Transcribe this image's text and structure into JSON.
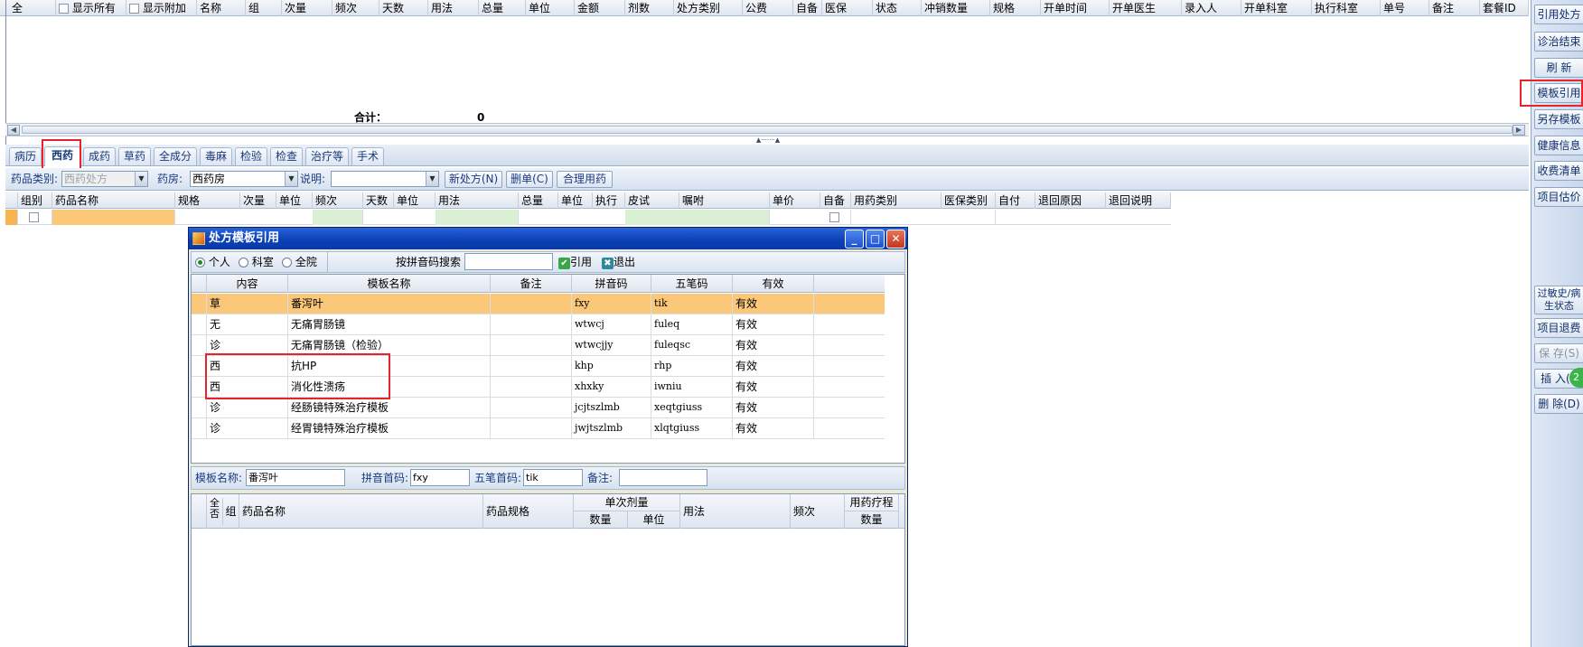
{
  "main_grid": {
    "headers": [
      "全",
      "",
      "显示所有",
      "显示附加",
      "名称",
      "组",
      "次量",
      "频次",
      "天数",
      "用法",
      "总量",
      "单位",
      "金额",
      "剂数",
      "处方类别",
      "公费",
      "自备",
      "医保",
      "状态",
      "冲销数量",
      "规格",
      "开单时间",
      "开单医生",
      "录入人",
      "开单科室",
      "执行科室",
      "单号",
      "备注",
      "套餐ID"
    ],
    "total_label": "合计：",
    "total_value": "0"
  },
  "tabs": [
    "病历",
    "西药",
    "成药",
    "草药",
    "全成分",
    "毒麻",
    "检验",
    "检查",
    "治疗等",
    "手术"
  ],
  "toolbar": {
    "category_label": "药品类别:",
    "category_value": "西药处方",
    "pharmacy_label": "药房:",
    "pharmacy_value": "西药房",
    "note_label": "说明:",
    "note_value": "",
    "new_rx_button": "新处方(N)",
    "delete_button": "删单(C)",
    "rational_button": "合理用药"
  },
  "order_grid": {
    "headers": [
      "组别",
      "药品名称",
      "规格",
      "次量",
      "单位",
      "频次",
      "天数",
      "单位",
      "用法",
      "总量",
      "单位",
      "执行",
      "皮试",
      "嘱咐",
      "单价",
      "自备",
      "用药类别",
      "医保类别",
      "自付",
      "退回原因",
      "退回说明"
    ]
  },
  "sidebar": {
    "buttons": [
      "引用处方",
      "诊治结束",
      "刷  新",
      "模板引用",
      "另存模板",
      "健康信息",
      "收费清单",
      "项目估价"
    ],
    "lower_buttons": [
      "过敏史/病生状态",
      "项目退费",
      "保  存(S)",
      "插  入(I)",
      "删  除(D)"
    ],
    "badge": "2"
  },
  "dialog": {
    "title": "处方模板引用",
    "scope_options": [
      "个人",
      "科室",
      "全院"
    ],
    "scope_selected": "个人",
    "search_label": "按拼音码搜索",
    "search_value": "",
    "cite_button": "引用",
    "exit_button": "退出",
    "headers": [
      "内容",
      "模板名称",
      "备注",
      "拼音码",
      "五笔码",
      "有效"
    ],
    "rows": [
      {
        "type": "草",
        "name": "番泻叶",
        "note": "",
        "pinyin": "fxy",
        "wubi": "tik",
        "valid": "有效"
      },
      {
        "type": "无",
        "name": "无痛胃肠镜",
        "note": "",
        "pinyin": "wtwcj",
        "wubi": "fuleq",
        "valid": "有效"
      },
      {
        "type": "诊",
        "name": "无痛胃肠镜（检验）",
        "note": "",
        "pinyin": "wtwcjjy",
        "wubi": "fuleqsc",
        "valid": "有效"
      },
      {
        "type": "西",
        "name": "抗HP",
        "note": "",
        "pinyin": "khp",
        "wubi": "rhp",
        "valid": "有效"
      },
      {
        "type": "西",
        "name": "消化性溃疡",
        "note": "",
        "pinyin": "xhxky",
        "wubi": "iwniu",
        "valid": "有效"
      },
      {
        "type": "诊",
        "name": "经肠镜特殊治疗模板",
        "note": "",
        "pinyin": "jcjtszlmb",
        "wubi": "xeqtgiuss",
        "valid": "有效"
      },
      {
        "type": "诊",
        "name": "经胃镜特殊治疗模板",
        "note": "",
        "pinyin": "jwjtszlmb",
        "wubi": "xlqtgiuss",
        "valid": "有效"
      }
    ],
    "info": {
      "name_label": "模板名称:",
      "name_value": "番泻叶",
      "pinyin_label": "拼音首码:",
      "pinyin_value": "fxy",
      "wubi_label": "五笔首码:",
      "wubi_value": "tik",
      "note_label": "备注:",
      "note_value": ""
    },
    "detail_headers": {
      "all": "全否",
      "group": "组",
      "drug_name": "药品名称",
      "drug_spec": "药品规格",
      "single_dose": "单次剂量",
      "qty": "数量",
      "unit": "单位",
      "usage": "用法",
      "frequency": "频次",
      "course": "用药疗程",
      "course_qty": "数量"
    }
  },
  "colors": {
    "selected_row": "#fbc87a",
    "title_bar": "#0b3fb4",
    "highlight_box": "#e8232a"
  }
}
